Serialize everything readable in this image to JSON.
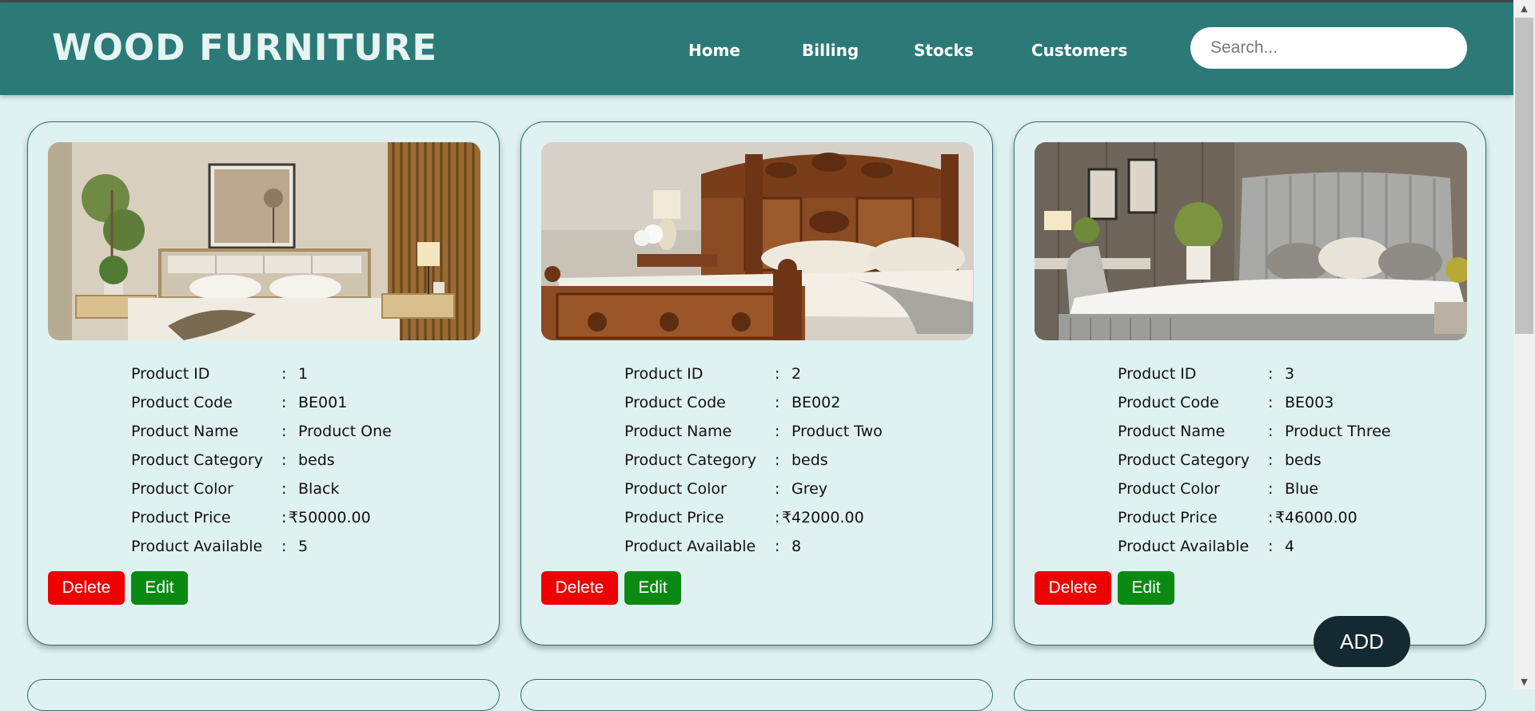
{
  "brand": "WOOD FURNITURE",
  "nav": {
    "home": "Home",
    "billing": "Billing",
    "stocks": "Stocks",
    "customers": "Customers"
  },
  "search": {
    "placeholder": "Search..."
  },
  "labels": {
    "id": "Product ID",
    "code": "Product Code",
    "name": "Product Name",
    "category": "Product Category",
    "color": "Product Color",
    "price": "Product Price",
    "available": "Product Available",
    "colon": ":",
    "currency": "₹"
  },
  "buttons": {
    "delete": "Delete",
    "edit": "Edit",
    "add": "ADD"
  },
  "products": [
    {
      "id": "1",
      "code": "BE001",
      "name": "Product One",
      "category": "beds",
      "color": "Black",
      "price": "50000.00",
      "available": "5",
      "image": "modern-bed-photo"
    },
    {
      "id": "2",
      "code": "BE002",
      "name": "Product Two",
      "category": "beds",
      "color": "Grey",
      "price": "42000.00",
      "available": "8",
      "image": "carved-wooden-bed-photo"
    },
    {
      "id": "3",
      "code": "BE003",
      "name": "Product Three",
      "category": "beds",
      "color": "Blue",
      "price": "46000.00",
      "available": "4",
      "image": "upholstered-bed-photo"
    }
  ],
  "colors": {
    "navbar": "#2c7a78",
    "page_bg": "#dff1f0",
    "delete": "#ee0000",
    "edit": "#0b8a13",
    "add": "#142a33"
  },
  "scrollbar": {
    "up_icon": "arrow-up-icon",
    "down_icon": "arrow-down-icon"
  }
}
